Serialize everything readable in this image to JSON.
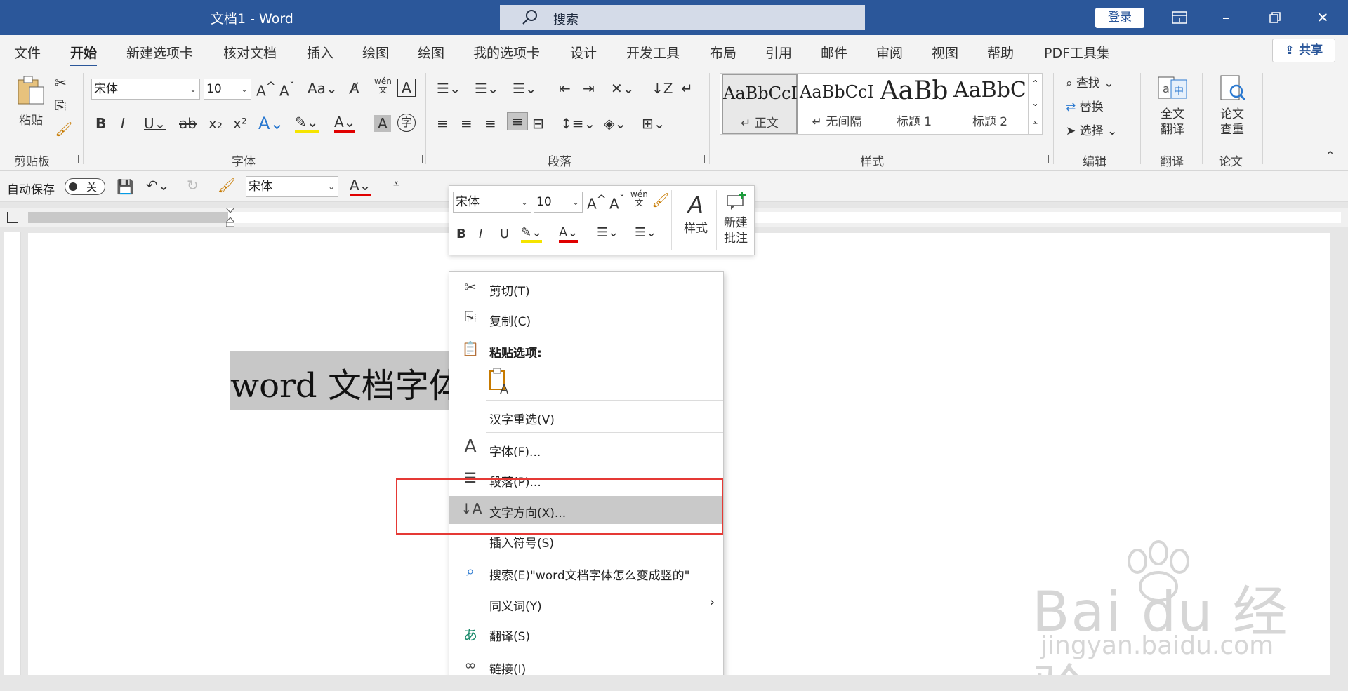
{
  "titlebar": {
    "doc_title": "文档1  -  Word",
    "search_placeholder": "搜索",
    "login": "登录"
  },
  "tabs": [
    "文件",
    "开始",
    "新建选项卡",
    "核对文档",
    "插入",
    "绘图",
    "绘图",
    "我的选项卡",
    "设计",
    "开发工具",
    "布局",
    "引用",
    "邮件",
    "审阅",
    "视图",
    "帮助",
    "PDF工具集"
  ],
  "share": "共享",
  "ribbon": {
    "clipboard": {
      "paste": "粘贴",
      "label": "剪贴板"
    },
    "font": {
      "name": "宋体",
      "size": "10",
      "label": "字体"
    },
    "paragraph": {
      "label": "段落"
    },
    "styles": {
      "label": "样式",
      "items": [
        {
          "sample": "AaBbCcI",
          "name": "↵ 正文"
        },
        {
          "sample": "AaBbCcI",
          "name": "↵ 无间隔"
        },
        {
          "sample": "AaBb",
          "name": "标题 1"
        },
        {
          "sample": "AaBbC",
          "name": "标题 2"
        }
      ]
    },
    "editing": {
      "find": "查找",
      "replace": "替换",
      "select": "选择",
      "label": "编辑"
    },
    "translate": {
      "btn_line1": "全文",
      "btn_line2": "翻译",
      "label": "翻译"
    },
    "paper": {
      "btn_line1": "论文",
      "btn_line2": "查重",
      "label": "论文"
    }
  },
  "qat": {
    "autosave": "自动保存",
    "toggle": "关",
    "font": "宋体"
  },
  "document": {
    "text": "word 文档字体怎么变成竖的"
  },
  "minitoolbar": {
    "font": "宋体",
    "size": "10",
    "styles": "样式",
    "new_comment_line1": "新建",
    "new_comment_line2": "批注"
  },
  "context_menu": {
    "cut": "剪切(T)",
    "copy": "复制(C)",
    "paste_options": "粘贴选项:",
    "hanzi": "汉字重选(V)",
    "font": "字体(F)...",
    "paragraph": "段落(P)...",
    "text_direction": "文字方向(X)...",
    "insert_symbol": "插入符号(S)",
    "search": "搜索(E)\"word文档字体怎么变成竖的\"",
    "synonyms": "同义词(Y)",
    "translate": "翻译(S)",
    "link": "链接(I)"
  },
  "watermark": {
    "line1": "Bai du 经验",
    "line2": "jingyan.baidu.com"
  },
  "colors": {
    "accent": "#2b579a",
    "highlight": "#e53935"
  }
}
